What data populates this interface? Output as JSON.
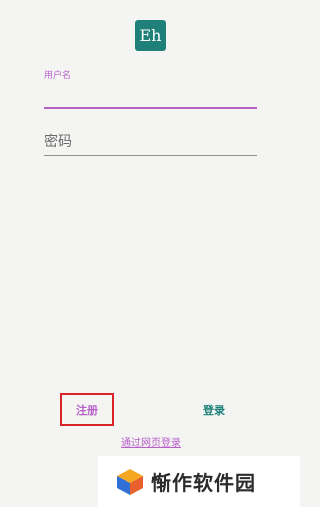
{
  "app": {
    "logo_text": "Eh"
  },
  "form": {
    "username_label": "用户名",
    "username_value": "",
    "password_placeholder": "密码",
    "password_value": ""
  },
  "actions": {
    "register_label": "注册",
    "login_label": "登录",
    "web_login_label": "通过网页登录"
  },
  "watermark": {
    "brand_text": "惭作软件园"
  },
  "colors": {
    "logo_bg": "#1e8079",
    "accent_purple": "#b861c9",
    "login_teal": "#1e8079",
    "highlight_red": "#d8232a"
  }
}
